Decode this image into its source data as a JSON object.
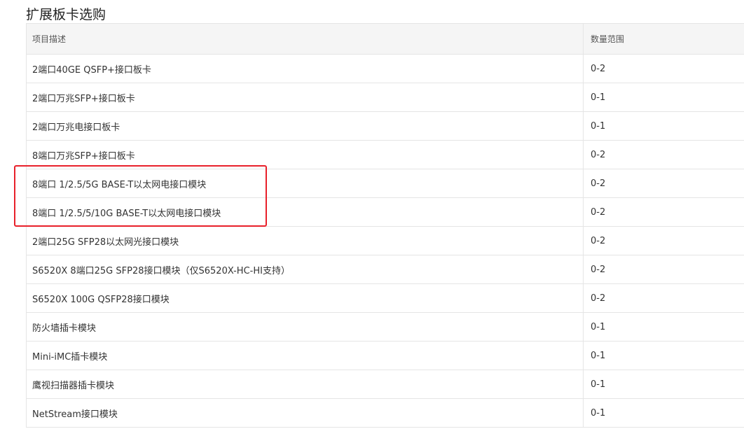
{
  "section": {
    "title": "扩展板卡选购"
  },
  "table": {
    "headers": {
      "description": "项目描述",
      "quantity": "数量范围"
    },
    "rows": [
      {
        "description": "2端口40GE QSFP+接口板卡",
        "quantity": "0-2"
      },
      {
        "description": "2端口万兆SFP+接口板卡",
        "quantity": "0-1"
      },
      {
        "description": "2端口万兆电接口板卡",
        "quantity": "0-1"
      },
      {
        "description": "8端口万兆SFP+接口板卡",
        "quantity": "0-2"
      },
      {
        "description": "8端口 1/2.5/5G BASE-T以太网电接口模块",
        "quantity": "0-2"
      },
      {
        "description": "8端口 1/2.5/5/10G BASE-T以太网电接口模块",
        "quantity": "0-2"
      },
      {
        "description": "2端口25G SFP28以太网光接口模块",
        "quantity": "0-2"
      },
      {
        "description": "S6520X 8端口25G SFP28接口模块（仅S6520X-HC-HI支持）",
        "quantity": "0-2"
      },
      {
        "description": "S6520X 100G QSFP28接口模块",
        "quantity": "0-2"
      },
      {
        "description": "防火墙插卡模块",
        "quantity": "0-1"
      },
      {
        "description": "Mini-iMC插卡模块",
        "quantity": "0-1"
      },
      {
        "description": "鹰视扫描器插卡模块",
        "quantity": "0-1"
      },
      {
        "description": "NetStream接口模块",
        "quantity": "0-1"
      }
    ]
  },
  "annotation": {
    "color": "#e8202a",
    "highlighted_rows": [
      4,
      5
    ]
  }
}
